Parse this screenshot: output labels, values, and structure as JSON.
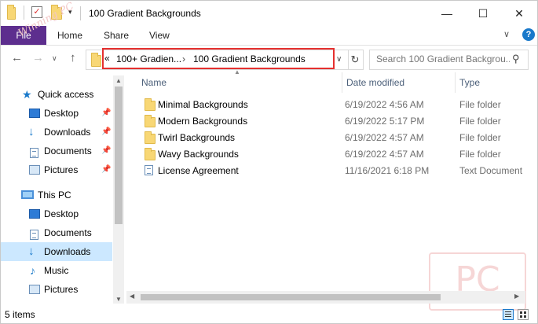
{
  "window": {
    "title": "100 Gradient Backgrounds",
    "minimize_glyph": "—",
    "maximize_glyph": "☐",
    "close_glyph": "✕"
  },
  "ribbon": {
    "tabs": [
      "File",
      "Home",
      "Share",
      "View"
    ],
    "file_color": "#5d2e8e"
  },
  "address": {
    "overflow_glyph": "«",
    "crumbs": [
      "100+ Gradien...",
      "100 Gradient Backgrounds"
    ],
    "separator": "›",
    "highlight_color": "#e5302f"
  },
  "search": {
    "placeholder": "Search 100 Gradient Backgrou..."
  },
  "sidebar": {
    "quick_access": "Quick access",
    "quick_items": [
      "Desktop",
      "Downloads",
      "Documents",
      "Pictures"
    ],
    "this_pc": "This PC",
    "pc_items": [
      "Desktop",
      "Documents",
      "Downloads",
      "Music",
      "Pictures"
    ],
    "selected": "Downloads"
  },
  "columns": {
    "name": "Name",
    "date": "Date modified",
    "type": "Type"
  },
  "files": [
    {
      "name": "Minimal Backgrounds",
      "date": "6/19/2022 4:56 AM",
      "type": "File folder",
      "icon": "folder-icon"
    },
    {
      "name": "Modern Backgrounds",
      "date": "6/19/2022 5:17 PM",
      "type": "File folder",
      "icon": "folder-icon"
    },
    {
      "name": "Twirl Backgrounds",
      "date": "6/19/2022 4:57 AM",
      "type": "File folder",
      "icon": "folder-icon"
    },
    {
      "name": "Wavy Backgrounds",
      "date": "6/19/2022 4:57 AM",
      "type": "File folder",
      "icon": "folder-icon"
    },
    {
      "name": "License Agreement",
      "date": "11/16/2021 6:18 PM",
      "type": "Text Document",
      "icon": "text-document-icon"
    }
  ],
  "status": {
    "count": "5 items"
  },
  "watermarks": {
    "diagonal": "Winning PC",
    "corner": "PC"
  },
  "colors": {
    "accent": "#1979ca",
    "selection": "#cce8ff",
    "folder": "#f8d775"
  }
}
